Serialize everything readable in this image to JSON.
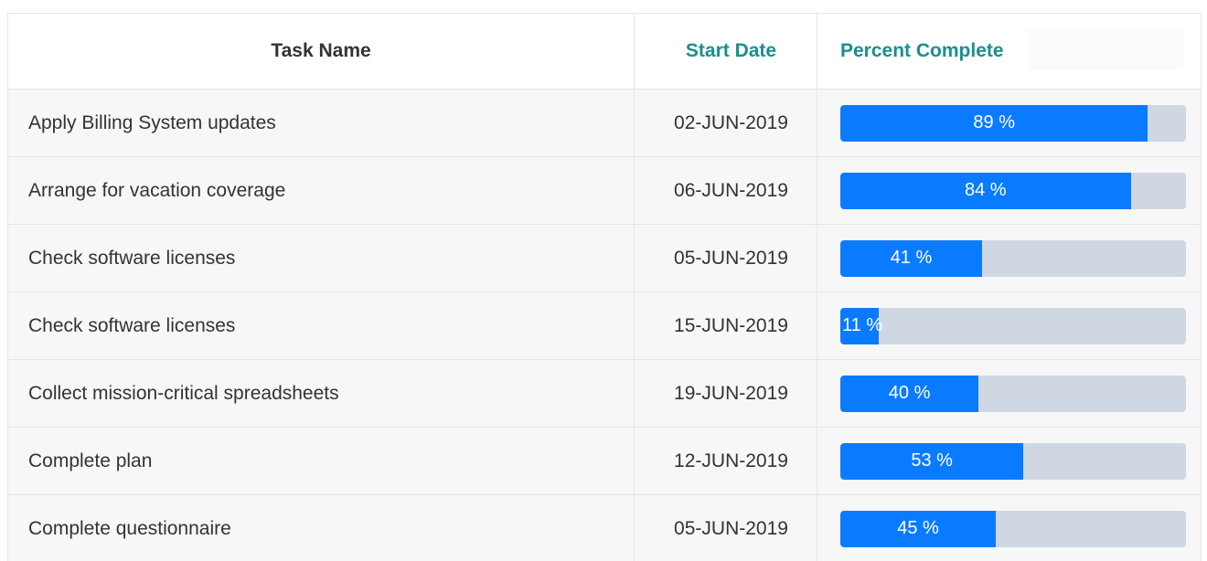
{
  "table": {
    "columns": {
      "task_name": "Task Name",
      "start_date": "Start Date",
      "percent_complete": "Percent Complete"
    },
    "rows": [
      {
        "task": "Apply Billing System updates",
        "start": "02-JUN-2019",
        "percent": 89,
        "percent_label": "89 %"
      },
      {
        "task": "Arrange for vacation coverage",
        "start": "06-JUN-2019",
        "percent": 84,
        "percent_label": "84 %"
      },
      {
        "task": "Check software licenses",
        "start": "05-JUN-2019",
        "percent": 41,
        "percent_label": "41 %"
      },
      {
        "task": "Check software licenses",
        "start": "15-JUN-2019",
        "percent": 11,
        "percent_label": "11 %"
      },
      {
        "task": "Collect mission-critical spreadsheets",
        "start": "19-JUN-2019",
        "percent": 40,
        "percent_label": "40 %"
      },
      {
        "task": "Complete plan",
        "start": "12-JUN-2019",
        "percent": 53,
        "percent_label": "53 %"
      },
      {
        "task": "Complete questionnaire",
        "start": "05-JUN-2019",
        "percent": 45,
        "percent_label": "45 %"
      }
    ]
  },
  "colors": {
    "accent_header": "#1a8f8f",
    "bar_fill": "#0a7bff",
    "bar_track": "#cfd8e2"
  }
}
